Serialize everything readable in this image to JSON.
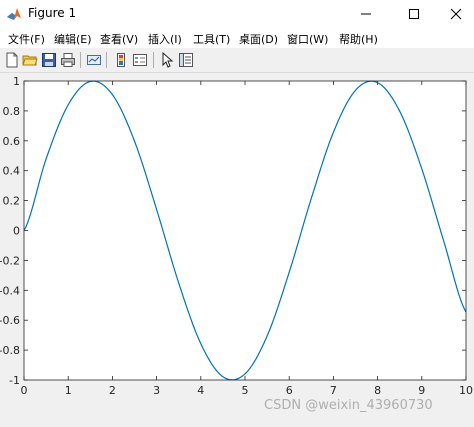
{
  "window": {
    "title": "Figure 1"
  },
  "menu": [
    {
      "label": "文件(F)"
    },
    {
      "label": "编辑(E)"
    },
    {
      "label": "查看(V)"
    },
    {
      "label": "插入(I)"
    },
    {
      "label": "工具(T)"
    },
    {
      "label": "桌面(D)"
    },
    {
      "label": "窗口(W)"
    },
    {
      "label": "帮助(H)"
    }
  ],
  "toolbar": {
    "icons": [
      "new-figure-icon",
      "open-file-icon",
      "save-icon",
      "print-icon",
      "link-plot-icon",
      "insert-colorbar-icon",
      "insert-legend-icon",
      "edit-plot-icon",
      "property-inspector-icon"
    ]
  },
  "colors": {
    "line": "#0072bd",
    "axes_bg": "#ffffff",
    "figure_bg": "#f0f0f0"
  },
  "chart_data": {
    "type": "line",
    "title": "",
    "xlabel": "",
    "ylabel": "",
    "xlim": [
      0,
      10
    ],
    "ylim": [
      -1,
      1
    ],
    "xticks": [
      "0",
      "1",
      "2",
      "3",
      "4",
      "5",
      "6",
      "7",
      "8",
      "9",
      "10"
    ],
    "yticks": [
      "1",
      "0.8",
      "0.6",
      "0.4",
      "0.2",
      "0",
      "-0.2",
      "-0.4",
      "-0.6",
      "-0.8",
      "-1"
    ],
    "grid": false,
    "series": [
      {
        "x": [
          0,
          0.5,
          1,
          1.5,
          2,
          2.5,
          3,
          3.5,
          4,
          4.5,
          5,
          5.5,
          6,
          6.5,
          7,
          7.5,
          8,
          8.5,
          9,
          9.5,
          10
        ],
        "values": [
          0,
          0.479,
          0.841,
          0.997,
          0.909,
          0.598,
          0.141,
          -0.351,
          -0.757,
          -0.978,
          -0.959,
          -0.706,
          -0.279,
          0.215,
          0.657,
          0.938,
          0.989,
          0.798,
          0.412,
          -0.075,
          -0.544
        ]
      }
    ]
  },
  "watermark": "CSDN @weixin_43960730"
}
